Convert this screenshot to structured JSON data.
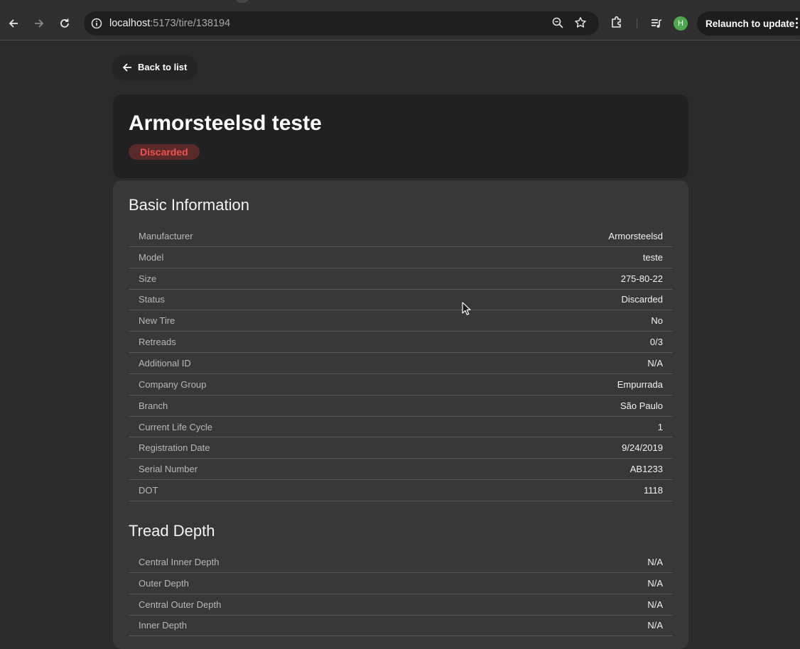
{
  "browser": {
    "url_host": "localhost",
    "url_path": ":5173/tire/138194",
    "avatar_letter": "H",
    "relaunch_label": "Relaunch to update"
  },
  "page": {
    "back_label": "Back to list",
    "title": "Armorsteelsd teste",
    "status_badge": "Discarded",
    "basic_info": {
      "heading": "Basic Information",
      "rows": [
        {
          "label": "Manufacturer",
          "value": "Armorsteelsd"
        },
        {
          "label": "Model",
          "value": "teste"
        },
        {
          "label": "Size",
          "value": "275-80-22"
        },
        {
          "label": "Status",
          "value": "Discarded"
        },
        {
          "label": "New Tire",
          "value": "No"
        },
        {
          "label": "Retreads",
          "value": "0/3"
        },
        {
          "label": "Additional ID",
          "value": "N/A"
        },
        {
          "label": "Company Group",
          "value": "Empurrada"
        },
        {
          "label": "Branch",
          "value": "São Paulo"
        },
        {
          "label": "Current Life Cycle",
          "value": "1"
        },
        {
          "label": "Registration Date",
          "value": "9/24/2019"
        },
        {
          "label": "Serial Number",
          "value": "AB1233"
        },
        {
          "label": "DOT",
          "value": "1118"
        }
      ]
    },
    "tread_depth": {
      "heading": "Tread Depth",
      "rows": [
        {
          "label": "Central Inner Depth",
          "value": "N/A"
        },
        {
          "label": "Outer Depth",
          "value": "N/A"
        },
        {
          "label": "Central Outer Depth",
          "value": "N/A"
        },
        {
          "label": "Inner Depth",
          "value": "N/A"
        }
      ]
    }
  },
  "colors": {
    "background": "#2b2b2b",
    "card": "#383838",
    "header_card": "#212121",
    "badge_text": "#ef5350",
    "badge_bg": "#5a2a2a"
  }
}
